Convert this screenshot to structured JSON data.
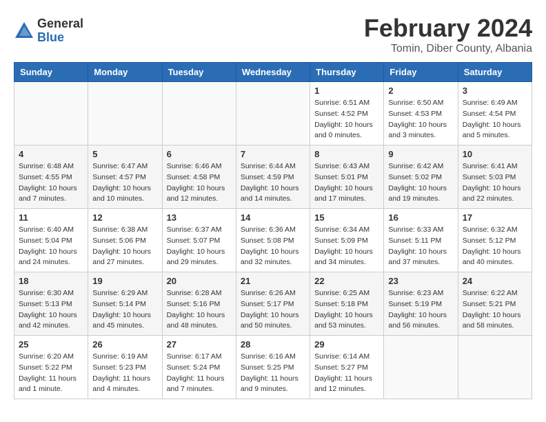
{
  "header": {
    "logo": {
      "general": "General",
      "blue": "Blue"
    },
    "title": "February 2024",
    "subtitle": "Tomin, Diber County, Albania"
  },
  "calendar": {
    "days_of_week": [
      "Sunday",
      "Monday",
      "Tuesday",
      "Wednesday",
      "Thursday",
      "Friday",
      "Saturday"
    ],
    "weeks": [
      [
        {
          "day": "",
          "info": ""
        },
        {
          "day": "",
          "info": ""
        },
        {
          "day": "",
          "info": ""
        },
        {
          "day": "",
          "info": ""
        },
        {
          "day": "1",
          "info": "Sunrise: 6:51 AM\nSunset: 4:52 PM\nDaylight: 10 hours\nand 0 minutes."
        },
        {
          "day": "2",
          "info": "Sunrise: 6:50 AM\nSunset: 4:53 PM\nDaylight: 10 hours\nand 3 minutes."
        },
        {
          "day": "3",
          "info": "Sunrise: 6:49 AM\nSunset: 4:54 PM\nDaylight: 10 hours\nand 5 minutes."
        }
      ],
      [
        {
          "day": "4",
          "info": "Sunrise: 6:48 AM\nSunset: 4:55 PM\nDaylight: 10 hours\nand 7 minutes."
        },
        {
          "day": "5",
          "info": "Sunrise: 6:47 AM\nSunset: 4:57 PM\nDaylight: 10 hours\nand 10 minutes."
        },
        {
          "day": "6",
          "info": "Sunrise: 6:46 AM\nSunset: 4:58 PM\nDaylight: 10 hours\nand 12 minutes."
        },
        {
          "day": "7",
          "info": "Sunrise: 6:44 AM\nSunset: 4:59 PM\nDaylight: 10 hours\nand 14 minutes."
        },
        {
          "day": "8",
          "info": "Sunrise: 6:43 AM\nSunset: 5:01 PM\nDaylight: 10 hours\nand 17 minutes."
        },
        {
          "day": "9",
          "info": "Sunrise: 6:42 AM\nSunset: 5:02 PM\nDaylight: 10 hours\nand 19 minutes."
        },
        {
          "day": "10",
          "info": "Sunrise: 6:41 AM\nSunset: 5:03 PM\nDaylight: 10 hours\nand 22 minutes."
        }
      ],
      [
        {
          "day": "11",
          "info": "Sunrise: 6:40 AM\nSunset: 5:04 PM\nDaylight: 10 hours\nand 24 minutes."
        },
        {
          "day": "12",
          "info": "Sunrise: 6:38 AM\nSunset: 5:06 PM\nDaylight: 10 hours\nand 27 minutes."
        },
        {
          "day": "13",
          "info": "Sunrise: 6:37 AM\nSunset: 5:07 PM\nDaylight: 10 hours\nand 29 minutes."
        },
        {
          "day": "14",
          "info": "Sunrise: 6:36 AM\nSunset: 5:08 PM\nDaylight: 10 hours\nand 32 minutes."
        },
        {
          "day": "15",
          "info": "Sunrise: 6:34 AM\nSunset: 5:09 PM\nDaylight: 10 hours\nand 34 minutes."
        },
        {
          "day": "16",
          "info": "Sunrise: 6:33 AM\nSunset: 5:11 PM\nDaylight: 10 hours\nand 37 minutes."
        },
        {
          "day": "17",
          "info": "Sunrise: 6:32 AM\nSunset: 5:12 PM\nDaylight: 10 hours\nand 40 minutes."
        }
      ],
      [
        {
          "day": "18",
          "info": "Sunrise: 6:30 AM\nSunset: 5:13 PM\nDaylight: 10 hours\nand 42 minutes."
        },
        {
          "day": "19",
          "info": "Sunrise: 6:29 AM\nSunset: 5:14 PM\nDaylight: 10 hours\nand 45 minutes."
        },
        {
          "day": "20",
          "info": "Sunrise: 6:28 AM\nSunset: 5:16 PM\nDaylight: 10 hours\nand 48 minutes."
        },
        {
          "day": "21",
          "info": "Sunrise: 6:26 AM\nSunset: 5:17 PM\nDaylight: 10 hours\nand 50 minutes."
        },
        {
          "day": "22",
          "info": "Sunrise: 6:25 AM\nSunset: 5:18 PM\nDaylight: 10 hours\nand 53 minutes."
        },
        {
          "day": "23",
          "info": "Sunrise: 6:23 AM\nSunset: 5:19 PM\nDaylight: 10 hours\nand 56 minutes."
        },
        {
          "day": "24",
          "info": "Sunrise: 6:22 AM\nSunset: 5:21 PM\nDaylight: 10 hours\nand 58 minutes."
        }
      ],
      [
        {
          "day": "25",
          "info": "Sunrise: 6:20 AM\nSunset: 5:22 PM\nDaylight: 11 hours\nand 1 minute."
        },
        {
          "day": "26",
          "info": "Sunrise: 6:19 AM\nSunset: 5:23 PM\nDaylight: 11 hours\nand 4 minutes."
        },
        {
          "day": "27",
          "info": "Sunrise: 6:17 AM\nSunset: 5:24 PM\nDaylight: 11 hours\nand 7 minutes."
        },
        {
          "day": "28",
          "info": "Sunrise: 6:16 AM\nSunset: 5:25 PM\nDaylight: 11 hours\nand 9 minutes."
        },
        {
          "day": "29",
          "info": "Sunrise: 6:14 AM\nSunset: 5:27 PM\nDaylight: 11 hours\nand 12 minutes."
        },
        {
          "day": "",
          "info": ""
        },
        {
          "day": "",
          "info": ""
        }
      ]
    ]
  }
}
